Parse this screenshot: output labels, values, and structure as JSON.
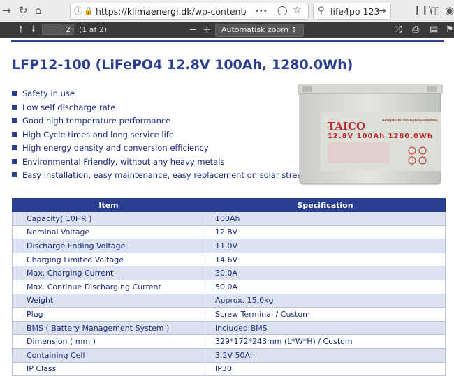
{
  "browser": {
    "url_prefix": "https://",
    "url_host": "klimaenergi.dk",
    "url_path": "/wp-content/uploa",
    "more_icon": "•••",
    "search_text": "life4po 123"
  },
  "pdf": {
    "page_number": "2",
    "page_count": "(1 af 2)",
    "zoom": "Automatisk zoom ↕"
  },
  "doc": {
    "title": "LFP12-100 (LiFePO4 12.8V 100Ah, 1280.0Wh)",
    "features": [
      "Safety in use",
      "Low self discharge rate",
      "Good high temperature performance",
      "High Cycle times and long service life",
      "High energy density and conversion efficiency",
      "Environmental Friendly, without any heavy metals",
      "Easy installation, easy maintenance, easy replacement on solar street light."
    ],
    "battery": {
      "brand": "TAICO",
      "label": "12.8V 100Ah 1280.0Wh",
      "subtitle": "Rechargeable Lithium Iron Phosphate (LiFePO4) Battery"
    },
    "table": {
      "headers": [
        "Item",
        "Specification"
      ],
      "rows": [
        [
          "Capacity( 10HR )",
          "100Ah"
        ],
        [
          "Nominal Voltage",
          "12.8V"
        ],
        [
          "Discharge Ending Voltage",
          "11.0V"
        ],
        [
          "Charging Limited Voltage",
          "14.6V"
        ],
        [
          "Max. Charging Current",
          "30.0A"
        ],
        [
          "Max. Continue Discharging Current",
          "50.0A"
        ],
        [
          "Weight",
          "Approx. 15.0kg"
        ],
        [
          "Plug",
          "Screw Terminal / Custom"
        ],
        [
          "BMS ( Battery Management System )",
          "Included BMS"
        ],
        [
          "Dimension ( mm )",
          "329*172*243mm (L*W*H) / Custom"
        ],
        [
          "Containing Cell",
          "3.2V 50Ah"
        ],
        [
          "IP Class",
          "IP30"
        ]
      ]
    }
  }
}
